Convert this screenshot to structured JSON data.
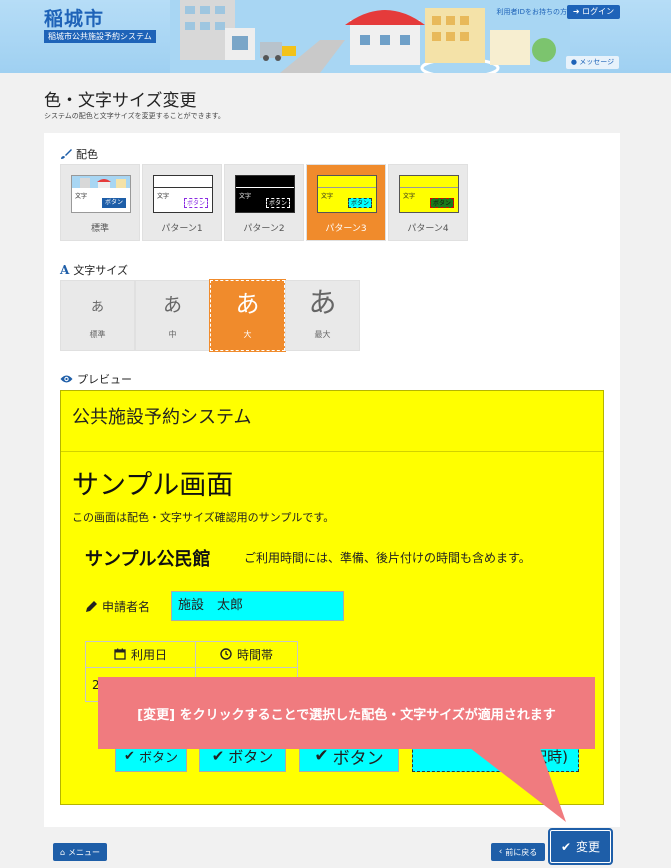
{
  "header": {
    "city": "稲城市",
    "system_name": "稲城市公共施設予約システム",
    "login_hint": "利用者IDをお持ちの方",
    "login_label": "ログイン",
    "message_label": "メッセージ"
  },
  "page": {
    "title": "色・文字サイズ変更",
    "description": "システムの配色と文字サイズを変更することができます。"
  },
  "color_section": {
    "label": "配色",
    "options": [
      {
        "name": "標準",
        "thumb_text": "文字",
        "thumb_button": "ボタン",
        "bg": "#ffffff",
        "fg": "#222222",
        "btn_bg": "#1e5ea8",
        "btn_fg": "#ffffff",
        "selected": false
      },
      {
        "name": "パターン1",
        "thumb_text": "文字",
        "thumb_button": "ボタン",
        "bg": "#ffffff",
        "fg": "#222222",
        "btn_bg": "#ffffff",
        "btn_fg": "#8a2be2",
        "selected": false
      },
      {
        "name": "パターン2",
        "thumb_text": "文字",
        "thumb_button": "ボタン",
        "bg": "#000000",
        "fg": "#ffffff",
        "btn_bg": "#000000",
        "btn_fg": "#ffffff",
        "selected": false
      },
      {
        "name": "パターン3",
        "thumb_text": "文字",
        "thumb_button": "ボタン",
        "bg": "#ffff00",
        "fg": "#222222",
        "btn_bg": "#00ffff",
        "btn_fg": "#222222",
        "selected": true
      },
      {
        "name": "パターン4",
        "thumb_text": "文字",
        "thumb_button": "ボタン",
        "bg": "#ffff00",
        "fg": "#222222",
        "btn_bg": "#1a7a1a",
        "btn_fg": "#111111",
        "selected": false
      }
    ]
  },
  "size_section": {
    "label": "文字サイズ",
    "options": [
      {
        "glyph": "あ",
        "name": "標準",
        "selected": false
      },
      {
        "glyph": "あ",
        "name": "中",
        "selected": false
      },
      {
        "glyph": "あ",
        "name": "大",
        "selected": true
      },
      {
        "glyph": "あ",
        "name": "最大",
        "selected": false
      }
    ]
  },
  "preview": {
    "label": "プレビュー",
    "system_title": "公共施設予約システム",
    "screen_title": "サンプル画面",
    "description": "この画面は配色・文字サイズ確認用のサンプルです。",
    "facility_name": "サンプル公民館",
    "facility_note": "ご利用時間には、準備、後片付けの時間も含めます。",
    "applicant_label": "申請者名",
    "applicant_value": "施設　太郎",
    "table_headers": [
      "利用日",
      "時間帯"
    ],
    "table_row": [
      "2",
      ""
    ],
    "buttons": [
      "ボタン",
      "ボタン",
      "ボタン",
      "(選択時)"
    ]
  },
  "callout": {
    "text": "[変更] をクリックすることで選択した配色・文字サイズが適用されます"
  },
  "footer": {
    "menu_label": "メニュー",
    "back_label": "前に戻る",
    "apply_label": "変更"
  },
  "colors": {
    "brand_blue": "#1e5ea8",
    "selected_orange": "#f08b2c",
    "preview_yellow": "#ffff00",
    "preview_cyan": "#00ffff",
    "callout_pink": "#f07b7f"
  }
}
